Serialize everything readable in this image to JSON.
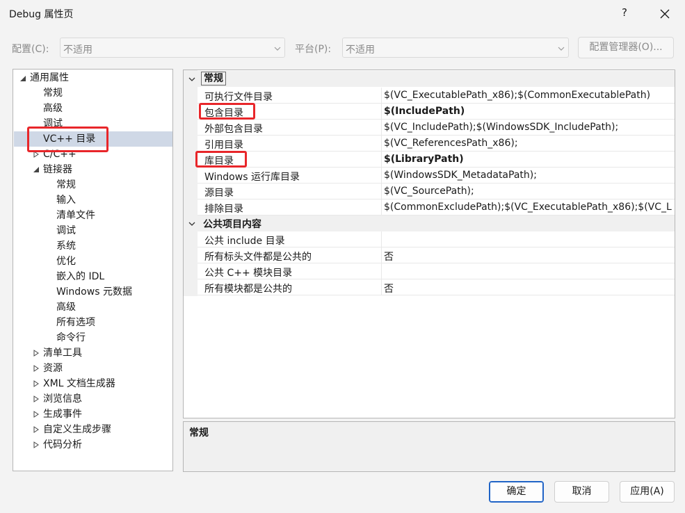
{
  "window": {
    "title": "Debug 属性页",
    "help": "?"
  },
  "config_bar": {
    "config_label": "配置(C):",
    "config_value": "不适用",
    "platform_label": "平台(P):",
    "platform_value": "不适用",
    "manager_button": "配置管理器(O)..."
  },
  "tree": {
    "root": "通用属性",
    "general": "常规",
    "advanced": "高级",
    "debugging": "调试",
    "vcpp_dirs": "VC++ 目录",
    "cpp": "C/C++",
    "linker": "链接器",
    "linker_children": [
      "常规",
      "输入",
      "清单文件",
      "调试",
      "系统",
      "优化",
      "嵌入的 IDL",
      "Windows 元数据",
      "高级",
      "所有选项",
      "命令行"
    ],
    "collapsed": [
      "清单工具",
      "资源",
      "XML 文档生成器",
      "浏览信息",
      "生成事件",
      "自定义生成步骤",
      "代码分析"
    ]
  },
  "grid": {
    "cat_general": "常规",
    "general_props": [
      {
        "name": "可执行文件目录",
        "value": "$(VC_ExecutablePath_x86);$(CommonExecutablePath)",
        "bold": false
      },
      {
        "name": "包含目录",
        "value": "$(IncludePath)",
        "bold": true
      },
      {
        "name": "外部包含目录",
        "value": "$(VC_IncludePath);$(WindowsSDK_IncludePath);",
        "bold": false
      },
      {
        "name": "引用目录",
        "value": "$(VC_ReferencesPath_x86);",
        "bold": false
      },
      {
        "name": "库目录",
        "value": "$(LibraryPath)",
        "bold": true
      },
      {
        "name": "Windows 运行库目录",
        "value": "$(WindowsSDK_MetadataPath);",
        "bold": false
      },
      {
        "name": "源目录",
        "value": "$(VC_SourcePath);",
        "bold": false
      },
      {
        "name": "排除目录",
        "value": "$(CommonExcludePath);$(VC_ExecutablePath_x86);$(VC_L",
        "bold": false
      }
    ],
    "cat_public": "公共项目内容",
    "public_props": [
      {
        "name": "公共 include 目录",
        "value": ""
      },
      {
        "name": "所有标头文件都是公共的",
        "value": "否"
      },
      {
        "name": "公共 C++ 模块目录",
        "value": ""
      },
      {
        "name": "所有模块都是公共的",
        "value": "否"
      }
    ]
  },
  "description": {
    "title": "常规"
  },
  "buttons": {
    "ok": "确定",
    "cancel": "取消",
    "apply": "应用(A)"
  },
  "colors": {
    "highlight_box": "#e8262a",
    "selection": "#cfd8e6",
    "primary_border": "#1f63c6"
  }
}
